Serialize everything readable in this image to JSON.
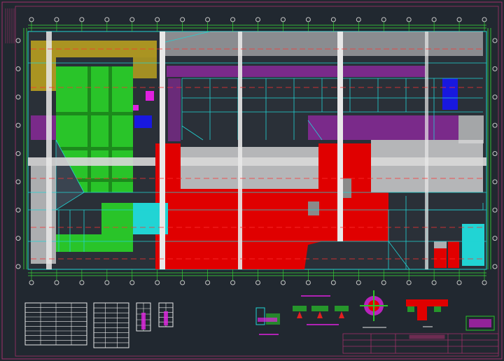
{
  "drawing": {
    "grid_columns": 19,
    "grid_rows": 9,
    "colors": {
      "background": "#212830",
      "border": "#a0306a",
      "axis": "#c8c8c8",
      "dimension": "#38e038",
      "wall": "#21d4d4",
      "structure": "#e8e8e8",
      "red_zone": "#e00000",
      "green_zone": "#29c429",
      "purple_zone": "#7a2a8a",
      "yellow_zone": "#d8c020",
      "blue_zone": "#1818e0",
      "magenta": "#e020e0"
    },
    "legend_tables": [
      {
        "kind": "schedule-table",
        "rows": 9,
        "cols": 4
      },
      {
        "kind": "schedule-table",
        "rows": 9,
        "cols": 3
      },
      {
        "kind": "legend-swatch-table",
        "rows": 5,
        "cols": 2
      },
      {
        "kind": "legend-swatch-table",
        "rows": 5,
        "cols": 2
      }
    ],
    "detail_views": [
      "detail-section-1",
      "detail-section-2",
      "detail-section-3",
      "detail-section-4",
      "detail-round-column",
      "detail-beam-joint",
      "detail-stamp"
    ],
    "title_block": {
      "rows": 3,
      "cols": 4
    }
  }
}
